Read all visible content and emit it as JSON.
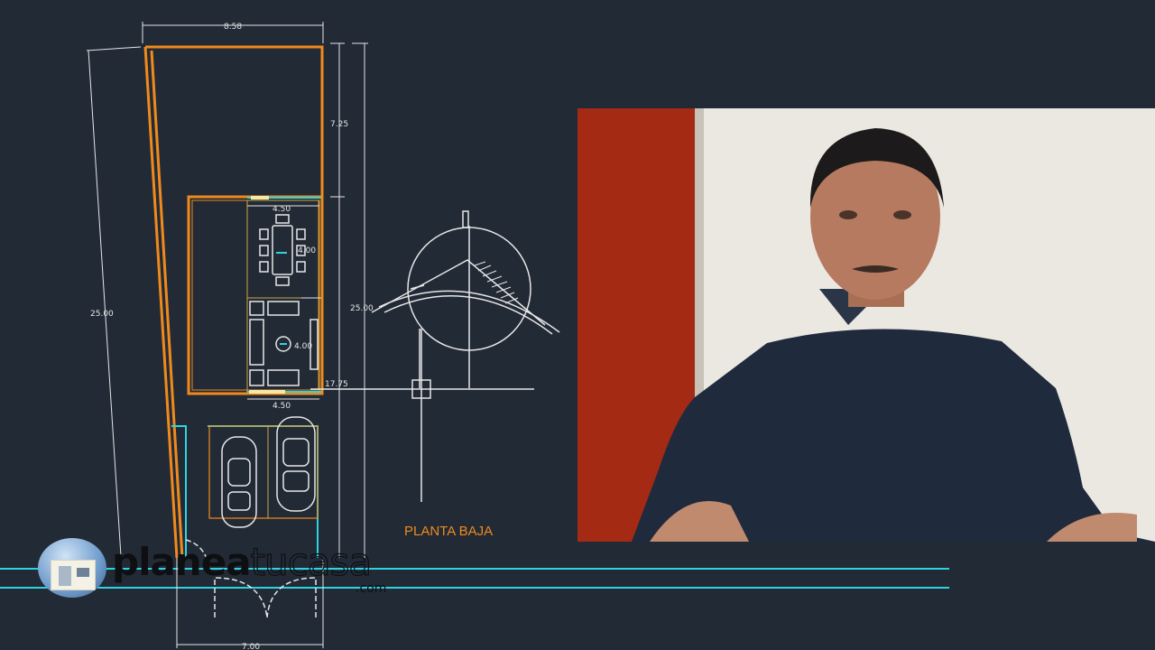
{
  "drawing": {
    "title": "PLANTA BAJA",
    "dimensions": {
      "top_width": "8.58",
      "left_length": "25.00",
      "right_length": "25.00",
      "front_setback": "7.25",
      "rear_setback": "17.75",
      "bottom_width": "7.00",
      "room_width_top": "4.50",
      "room_width_bottom": "4.50",
      "dining_depth": "4.00",
      "living_depth": "4.00"
    }
  },
  "logo": {
    "text_bold": "planea",
    "text_light": "tucasa",
    "suffix": ".com"
  },
  "colors": {
    "background": "#222a36",
    "lines": "#e6e6e6",
    "walls": "#f08a1c",
    "cyan": "#2fd3e0"
  }
}
